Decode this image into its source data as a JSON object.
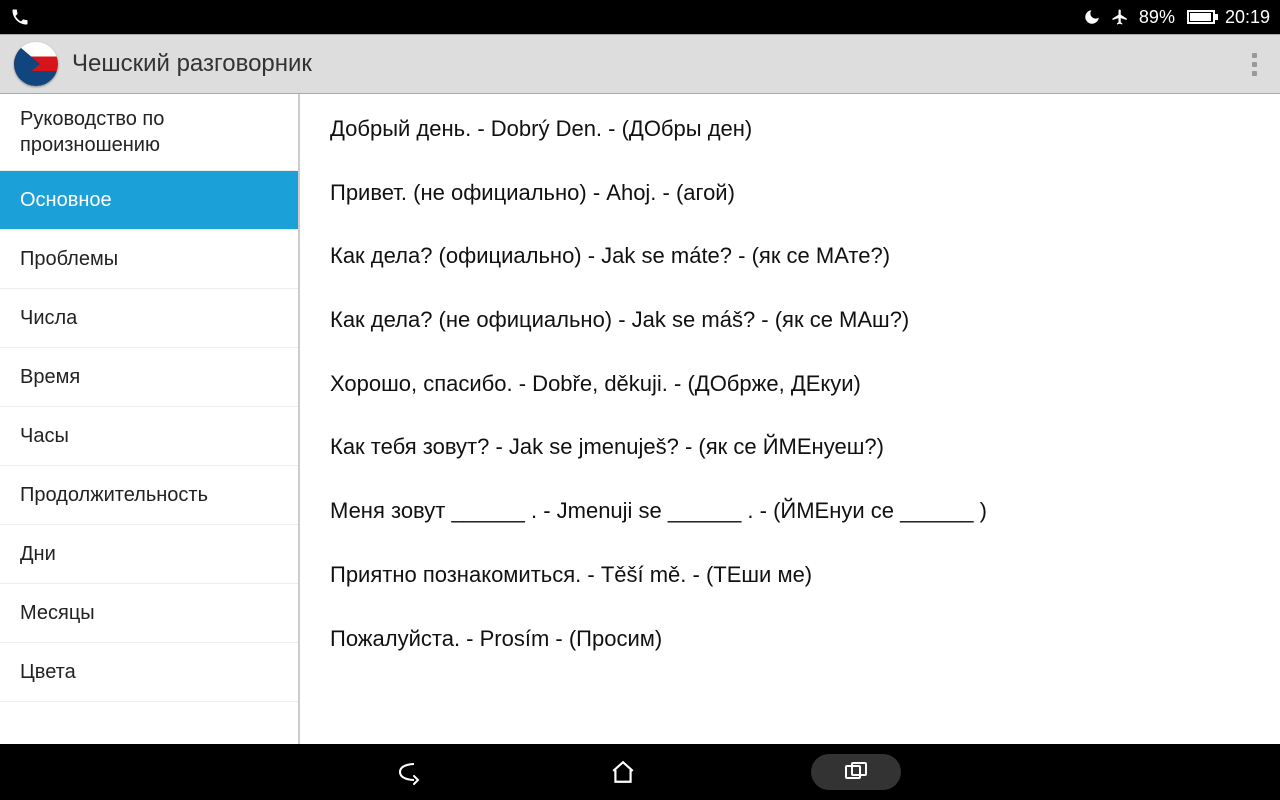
{
  "statusbar": {
    "battery_pct": "89%",
    "time": "20:19"
  },
  "appbar": {
    "title": "Чешский разговорник"
  },
  "sidebar": {
    "items": [
      {
        "label": "Руководство по произношению",
        "selected": false,
        "two_line": true
      },
      {
        "label": "Основное",
        "selected": true
      },
      {
        "label": "Проблемы",
        "selected": false
      },
      {
        "label": "Числа",
        "selected": false
      },
      {
        "label": "Время",
        "selected": false
      },
      {
        "label": "Часы",
        "selected": false
      },
      {
        "label": "Продолжительность",
        "selected": false
      },
      {
        "label": "Дни",
        "selected": false
      },
      {
        "label": "Месяцы",
        "selected": false
      },
      {
        "label": "Цвета",
        "selected": false
      }
    ]
  },
  "phrases": [
    "Добрый день. - Dobrý Den. - (ДОбры ден)",
    "Привет. (не официально) - Ahoj. - (агой)",
    "Как дела? (официально) - Jak se máte? - (як се МАте?)",
    "Как дела? (не официально) - Jak se máš? - (як се МАш?)",
    "Хорошо, спасибо. - Dobře, děkuji. - (ДОбрже, ДЕкуи)",
    "Как тебя зовут? - Jak se jmenuješ? - (як се ЙМЕнуеш?)",
    "Меня зовут ______ . - Jmenuji se ______ . - (ЙМЕнуи се ______ )",
    "Приятно познакомиться. - Těší mě. - (ТЕши ме)",
    "Пожалуйста. - Prosím - (Просим)"
  ]
}
